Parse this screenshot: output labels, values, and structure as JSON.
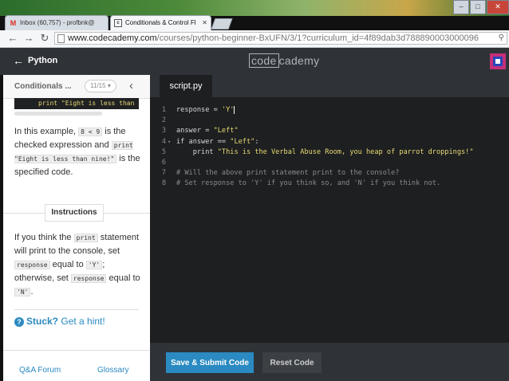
{
  "browser": {
    "tabs": [
      {
        "label": "Inbox (60,757) - profbnk@",
        "icon": "gmail-icon"
      },
      {
        "label": "Conditionals & Control Fl",
        "icon": "codecademy-icon"
      }
    ],
    "url_host": "www.codecademy.com",
    "url_path": "/courses/python-beginner-BxUFN/3/1?curriculum_id=4f89dab3d788890003000096"
  },
  "header": {
    "course": "Python",
    "logo_left": "code",
    "logo_right": "cademy"
  },
  "lesson": {
    "name": "Conditionals ...",
    "pager": "11/15",
    "snippet": "print \"Eight is less than nine!\"",
    "para1": {
      "t1": "In this example, ",
      "c1": "8 < 9",
      "t2": " is the checked expression and ",
      "c2": "print \"Eight is less than nine!\"",
      "t3": " is the specified code."
    },
    "instructions_label": "Instructions",
    "para2": {
      "t1": "If you think the ",
      "c1": "print",
      "t2": " statement will print to the console, set ",
      "c2": "response",
      "t3": " equal to ",
      "c3": "'Y'",
      "t4": "; otherwise, set ",
      "c4": "response",
      "t5": " equal to ",
      "c5": "'N'",
      "t6": "."
    },
    "hint_bold": "Stuck?",
    "hint_link": "Get a hint!",
    "qa_link": "Q&A Forum",
    "glossary_link": "Glossary"
  },
  "editor": {
    "file_tab": "script.py",
    "lines": [
      {
        "n": "1",
        "a": "response = ",
        "s": "'Y'",
        "b": ""
      },
      {
        "n": "2",
        "a": "",
        "s": "",
        "b": ""
      },
      {
        "n": "3",
        "a": "answer = ",
        "s": "\"Left\"",
        "b": ""
      },
      {
        "n": "4",
        "a": "if answer == ",
        "s": "\"Left\"",
        "b": ":"
      },
      {
        "n": "5",
        "a": "    print ",
        "s": "\"This is the Verbal Abuse Room, you heap of parrot droppings!\"",
        "b": ""
      },
      {
        "n": "6",
        "a": "",
        "s": "",
        "b": ""
      },
      {
        "n": "7",
        "c": "# Will the above print statement print to the console?"
      },
      {
        "n": "8",
        "c": "# Set response to 'Y' if you think so, and 'N' if you think not."
      }
    ],
    "submit_label": "Save & Submit Code",
    "reset_label": "Reset Code"
  }
}
